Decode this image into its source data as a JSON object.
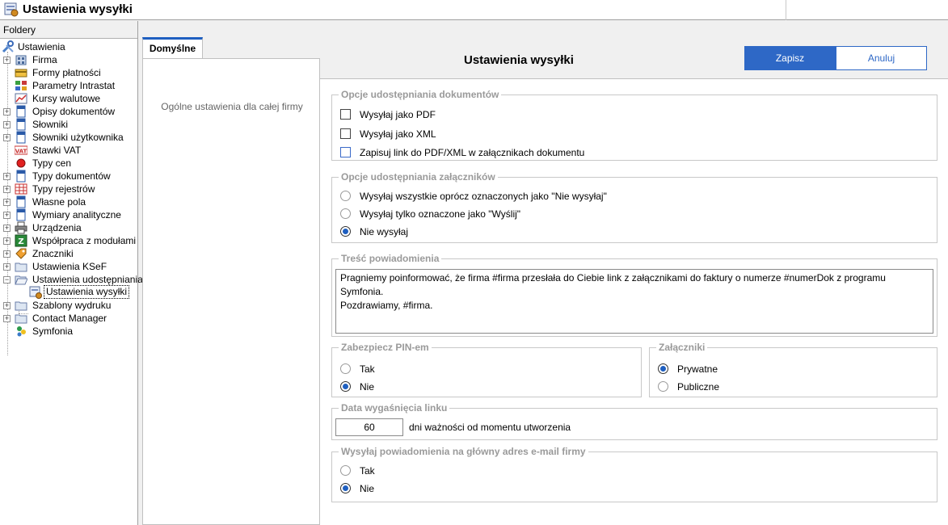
{
  "window": {
    "title": "Ustawienia wysyłki"
  },
  "folders": {
    "header": "Foldery",
    "items": [
      {
        "label": "Ustawienia",
        "icon": "tools-icon"
      },
      {
        "label": "Firma",
        "icon": "building-icon"
      },
      {
        "label": "Formy płatności",
        "icon": "payment-icon"
      },
      {
        "label": "Parametry Intrastat",
        "icon": "intrastat-icon"
      },
      {
        "label": "Kursy walutowe",
        "icon": "currency-chart-icon"
      },
      {
        "label": "Opisy dokumentów",
        "icon": "document-icon"
      },
      {
        "label": "Słowniki",
        "icon": "dictionary-icon"
      },
      {
        "label": "Słowniki użytkownika",
        "icon": "user-dictionary-icon"
      },
      {
        "label": "Stawki VAT",
        "icon": "vat-icon"
      },
      {
        "label": "Typy cen",
        "icon": "price-type-icon"
      },
      {
        "label": "Typy dokumentów",
        "icon": "document-types-icon"
      },
      {
        "label": "Typy rejestrów",
        "icon": "register-types-icon"
      },
      {
        "label": "Własne pola",
        "icon": "custom-fields-icon"
      },
      {
        "label": "Wymiary analityczne",
        "icon": "analytics-icon"
      },
      {
        "label": "Urządzenia",
        "icon": "printer-icon"
      },
      {
        "label": "Współpraca z modułami",
        "icon": "modules-icon"
      },
      {
        "label": "Znaczniki",
        "icon": "tags-icon"
      },
      {
        "label": "Ustawienia KSeF",
        "icon": "folder-icon"
      },
      {
        "label": "Ustawienia udostępniania",
        "icon": "folder-open-icon"
      },
      {
        "label": "Ustawienia wysyłki",
        "icon": "settings-send-icon"
      },
      {
        "label": "Szablony wydruku",
        "icon": "folder-icon"
      },
      {
        "label": "Contact Manager",
        "icon": "folder-icon"
      },
      {
        "label": "Symfonia",
        "icon": "symfonia-icon"
      }
    ]
  },
  "tab": {
    "label": "Domyślne"
  },
  "left_pane": {
    "description": "Ogólne ustawienia dla całej firmy"
  },
  "header": {
    "title": "Ustawienia wysyłki",
    "save_label": "Zapisz",
    "cancel_label": "Anuluj"
  },
  "doc_sharing": {
    "title": "Opcje udostępniania dokumentów",
    "options": [
      {
        "label": "Wysyłaj jako PDF",
        "checked": false
      },
      {
        "label": "Wysyłaj jako XML",
        "checked": false
      },
      {
        "label": "Zapisuj link do PDF/XML w załącznikach dokumentu",
        "checked": false
      }
    ]
  },
  "attachment_sharing": {
    "title": "Opcje udostępniania załączników",
    "options": [
      {
        "label": "Wysyłaj wszystkie oprócz oznaczonych jako \"Nie wysyłaj\"",
        "selected": false
      },
      {
        "label": "Wysyłaj tylko oznaczone jako \"Wyślij\"",
        "selected": false
      },
      {
        "label": "Nie wysyłaj",
        "selected": true
      }
    ]
  },
  "notification": {
    "title": "Treść powiadomienia",
    "line1": "Pragniemy poinformować, że firma #firma przesłała do Ciebie link z załącznikami do faktury o numerze #numerDok z programu Symfonia.",
    "line2": "Pozdrawiamy, #firma."
  },
  "pin": {
    "title": "Zabezpiecz PIN-em",
    "options": [
      {
        "label": "Tak",
        "selected": false
      },
      {
        "label": "Nie",
        "selected": true
      }
    ]
  },
  "attachments": {
    "title": "Załączniki",
    "options": [
      {
        "label": "Prywatne",
        "selected": true
      },
      {
        "label": "Publiczne",
        "selected": false
      }
    ]
  },
  "link_expiry": {
    "title": "Data wygaśnięcia linku",
    "value": "60",
    "label": "dni ważności od momentu utworzenia"
  },
  "main_email": {
    "title": "Wysyłaj powiadomienia na główny adres e-mail firmy",
    "options": [
      {
        "label": "Tak",
        "selected": false
      },
      {
        "label": "Nie",
        "selected": true
      }
    ]
  }
}
